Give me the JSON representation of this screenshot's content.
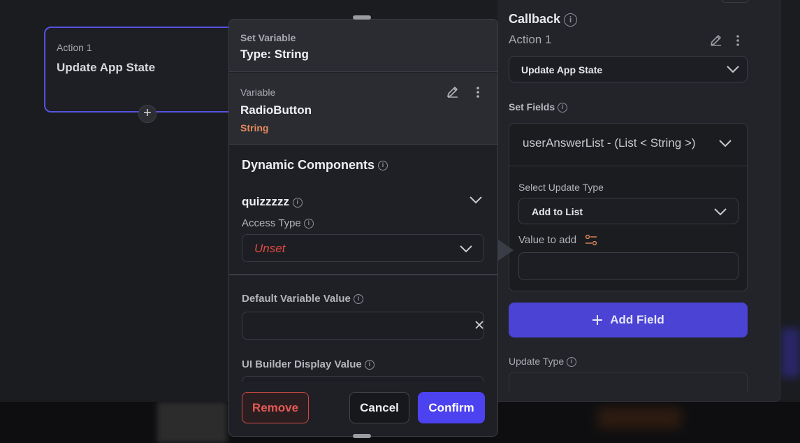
{
  "action_node": {
    "subtitle": "Action 1",
    "title": "Update App State",
    "add_symbol": "+"
  },
  "right_panel": {
    "title": "Callback",
    "action_label": "Action 1",
    "action_dropdown_value": "Update App State",
    "set_fields_label": "Set Fields",
    "field": {
      "name": "userAnswerList - (List < String >)",
      "select_update_type_label": "Select Update Type",
      "update_type_value": "Add to List",
      "value_to_add_label": "Value to add",
      "value_to_add": ""
    },
    "add_field_label": "Add Field",
    "update_type_label": "Update Type"
  },
  "popup": {
    "header_subtitle": "Set Variable",
    "header_title": "Type: String",
    "variable": {
      "label": "Variable",
      "name": "RadioButton",
      "type": "String"
    },
    "dynamic_components_title": "Dynamic Components",
    "component_name": "quizzzzz",
    "access_type_label": "Access Type",
    "access_type_value": "Unset",
    "default_value_label": "Default Variable Value",
    "default_value": "",
    "ui_builder_label": "UI Builder Display Value",
    "ui_builder_value": "",
    "buttons": {
      "remove": "Remove",
      "cancel": "Cancel",
      "confirm": "Confirm"
    }
  },
  "colors": {
    "accent": "#4d42f0",
    "add_field_bg": "#4a43d4",
    "danger": "#e24a43",
    "string_type": "#e58a5e",
    "node_border": "#5552e0"
  },
  "icons": [
    "info-icon",
    "edit-icon",
    "more-vertical-icon",
    "chevron-down-icon",
    "plus-icon",
    "close-icon",
    "sliders-icon"
  ]
}
